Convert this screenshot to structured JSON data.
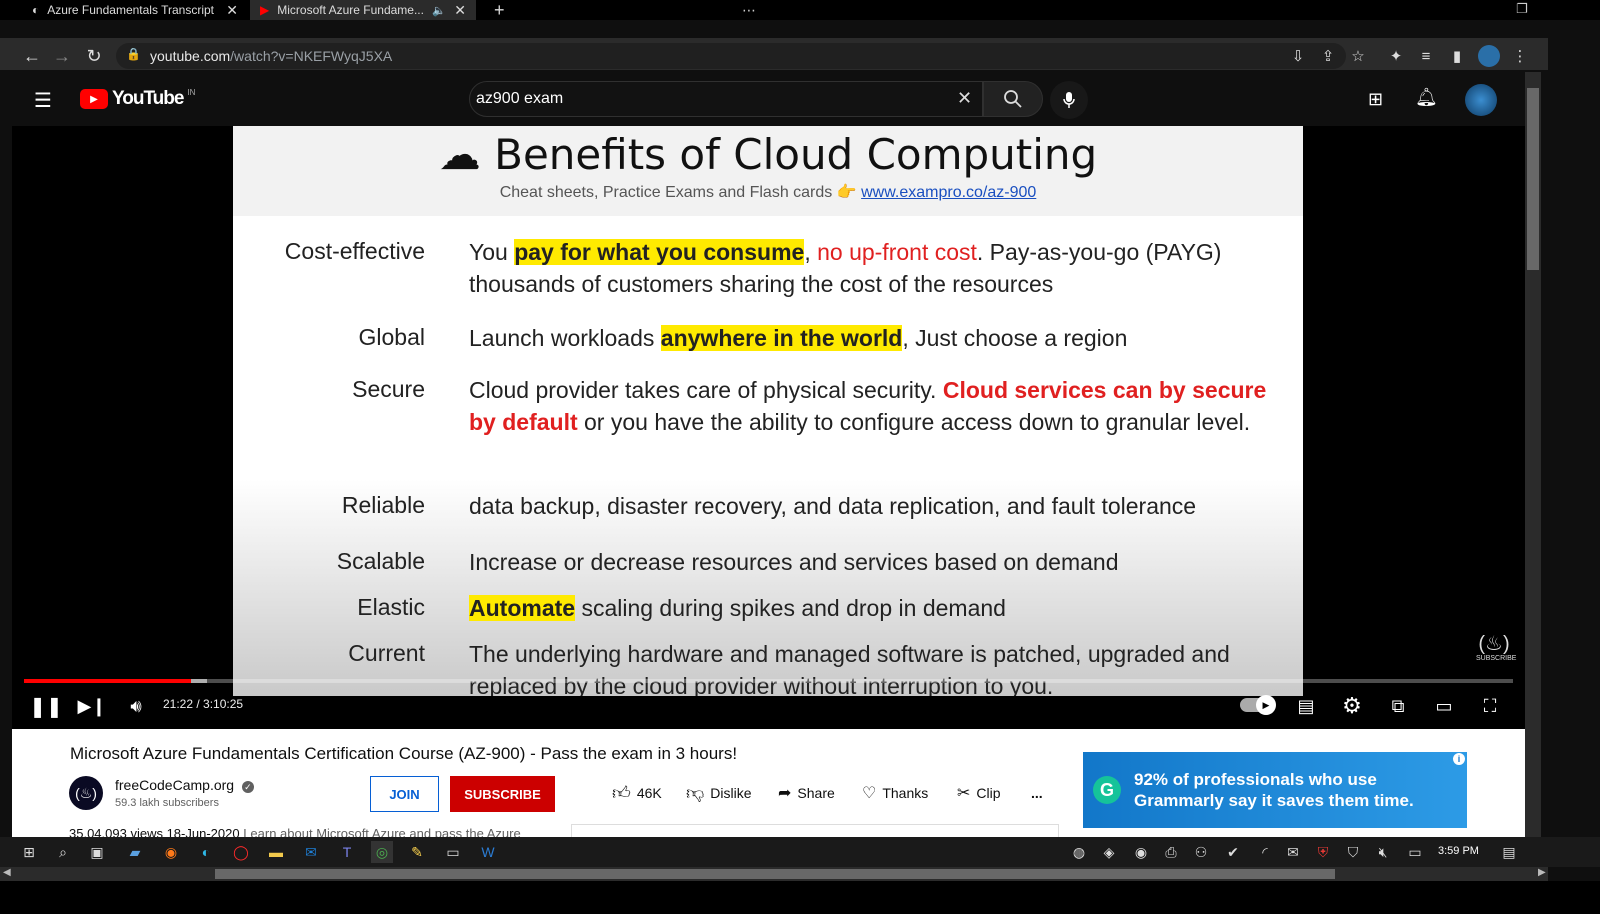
{
  "browser": {
    "tabs": [
      {
        "label": "Azure Fundamentals Transcript",
        "close": "✕"
      },
      {
        "label": "Microsoft Azure Fundame...",
        "close": "✕"
      }
    ],
    "new_tab": "+",
    "url_host": "youtube.com",
    "url_path": "/watch?v=NKEFWyqJ5XA"
  },
  "youtube": {
    "logo_text": "YouTube",
    "region": "IN",
    "search_value": "az900 exam"
  },
  "slide": {
    "title": "☁ Benefits of Cloud Computing",
    "subtitle": "Cheat sheets, Practice Exams and Flash cards 👉",
    "link": "www.exampro.co/az-900",
    "rows": [
      {
        "term": "Cost-effective",
        "parts": [
          [
            "You ",
            ""
          ],
          [
            "pay for what you consume",
            "hl"
          ],
          [
            ", ",
            ""
          ],
          [
            "no up-front cost",
            "red"
          ],
          [
            ". Pay-as-you-go (PAYG) thousands of customers sharing the cost of the resources",
            ""
          ]
        ]
      },
      {
        "term": "Global",
        "parts": [
          [
            "Launch workloads ",
            ""
          ],
          [
            "anywhere in the world",
            "hl"
          ],
          [
            ", Just choose a region",
            ""
          ]
        ]
      },
      {
        "term": "Secure",
        "parts": [
          [
            "Cloud provider takes care of physical security. ",
            ""
          ],
          [
            "Cloud services can by secure by default",
            "redb"
          ],
          [
            " or you have the ability to configure access down to granular level.",
            ""
          ]
        ]
      },
      {
        "term": "Reliable",
        "parts": [
          [
            "data backup, disaster recovery, and data replication, and fault tolerance",
            ""
          ]
        ]
      },
      {
        "term": "Scalable",
        "parts": [
          [
            "Increase or decrease resources and services based on demand",
            ""
          ]
        ]
      },
      {
        "term": "Elastic",
        "parts": [
          [
            "Automate",
            "hl"
          ],
          [
            " scaling during spikes and drop in demand",
            ""
          ]
        ]
      },
      {
        "term": "Current",
        "parts": [
          [
            "The underlying hardware and managed software is patched, upgraded and replaced by the cloud provider without interruption to you.",
            ""
          ]
        ]
      }
    ]
  },
  "player": {
    "time": "21:22 / 3:10:25",
    "progress_fraction": 0.112,
    "buffer_fraction": 0.123,
    "watermark": "SUBSCRIBE"
  },
  "video": {
    "title": "Microsoft Azure Fundamentals Certification Course (AZ-900) - Pass the exam in 3 hours!",
    "channel": "freeCodeCamp.org",
    "subscribers": "59.3 lakh subscribers",
    "join_label": "JOIN",
    "subscribe_label": "SUBSCRIBE",
    "likes": "46K",
    "dislike_label": "Dislike",
    "share_label": "Share",
    "thanks_label": "Thanks",
    "clip_label": "Clip",
    "more_label": "...",
    "views": "35,04,093 views  18-Jun-2020",
    "description_snippet": "Learn about Microsoft Azure and pass the Azure"
  },
  "ad": {
    "line1": "92% of professionals who use",
    "line2": "Grammarly say it saves them time."
  },
  "taskbar": {
    "clock": "3:59 PM"
  }
}
